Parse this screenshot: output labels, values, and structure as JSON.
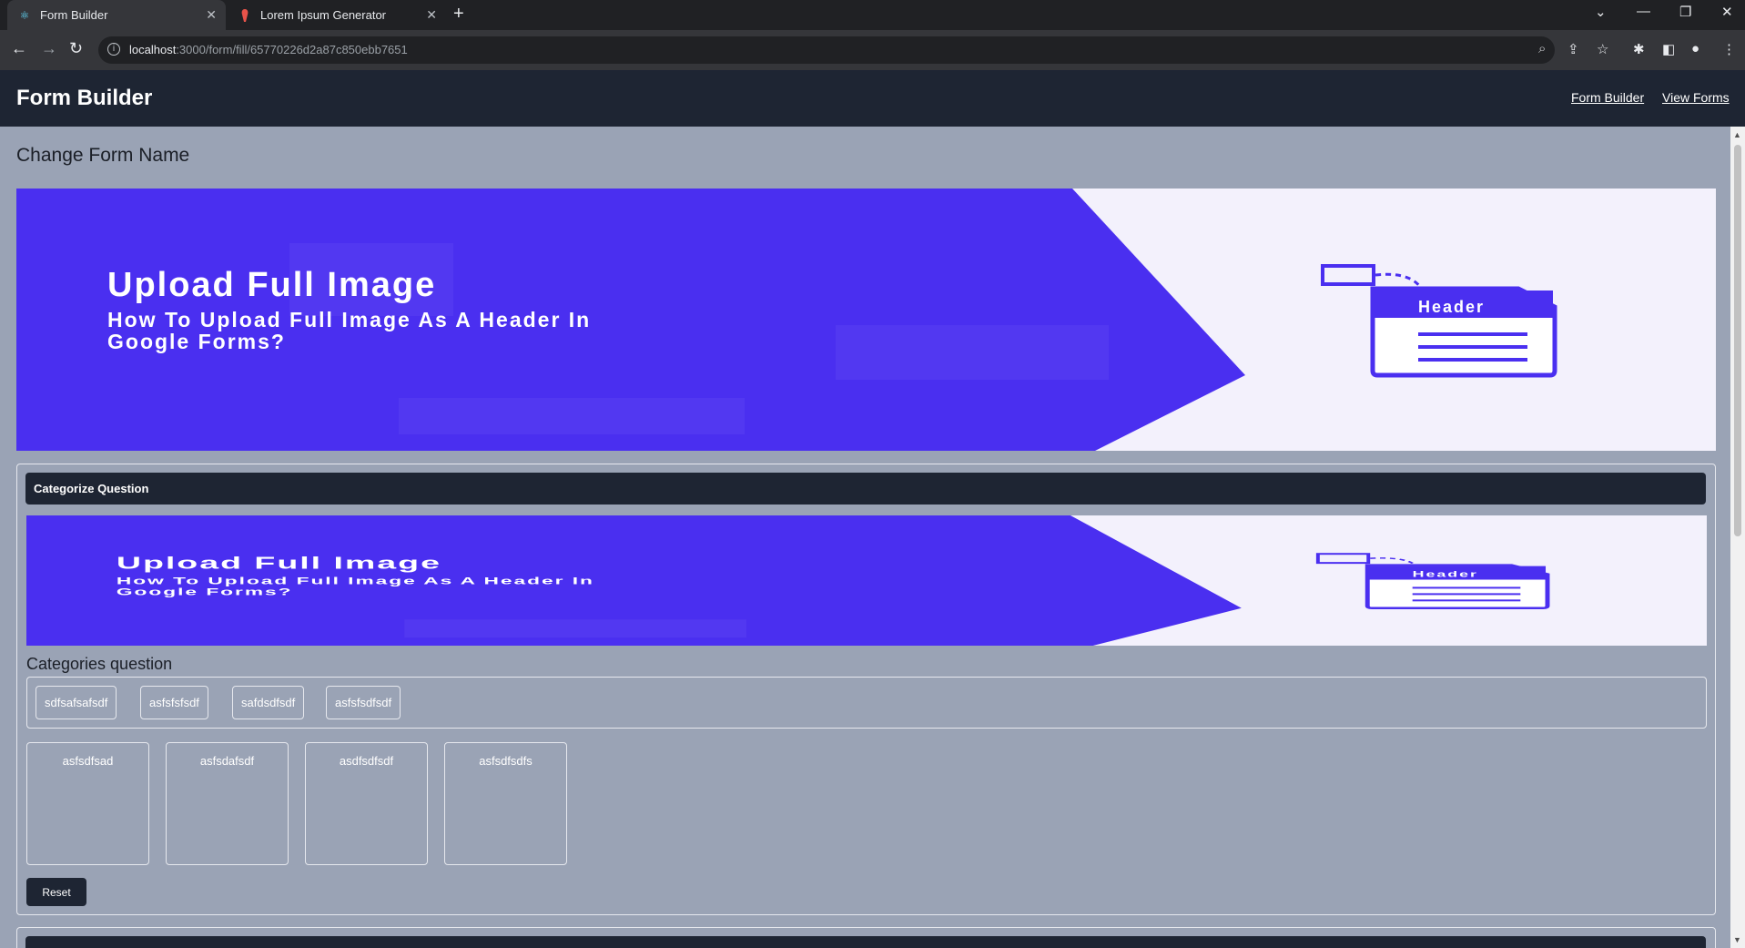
{
  "browser": {
    "tabs": [
      {
        "title": "Form Builder",
        "icon": "react-icon",
        "active": true
      },
      {
        "title": "Lorem Ipsum Generator",
        "icon": "lorem-icon",
        "active": false
      }
    ],
    "url_host": "localhost",
    "url_path": ":3000/form/fill/65770226d2a87c850ebb7651"
  },
  "header": {
    "title": "Form Builder",
    "links": [
      "Form Builder",
      "View Forms"
    ]
  },
  "form": {
    "name": "Change Form Name",
    "banner": {
      "title": "Upload Full Image",
      "subtitle_line1": "How To Upload Full Image As A Header In",
      "subtitle_line2": "Google Forms?",
      "doc_label": "Header"
    },
    "question": {
      "heading": "Categorize Question",
      "label": "Categories question",
      "items": [
        "sdfsafsafsdf",
        "asfsfsfsdf",
        "safdsdfsdf",
        "asfsfsdfsdf"
      ],
      "categories": [
        "asfsdfsad",
        "asfsdafsdf",
        "asdfsdfsdf",
        "asfsdfsdfs"
      ],
      "reset_label": "Reset"
    }
  },
  "colors": {
    "page_bg": "#9aa3b5",
    "header_bg": "#1e2533",
    "banner_purple": "#4a2ff0",
    "banner_light": "#f3f1fc"
  }
}
